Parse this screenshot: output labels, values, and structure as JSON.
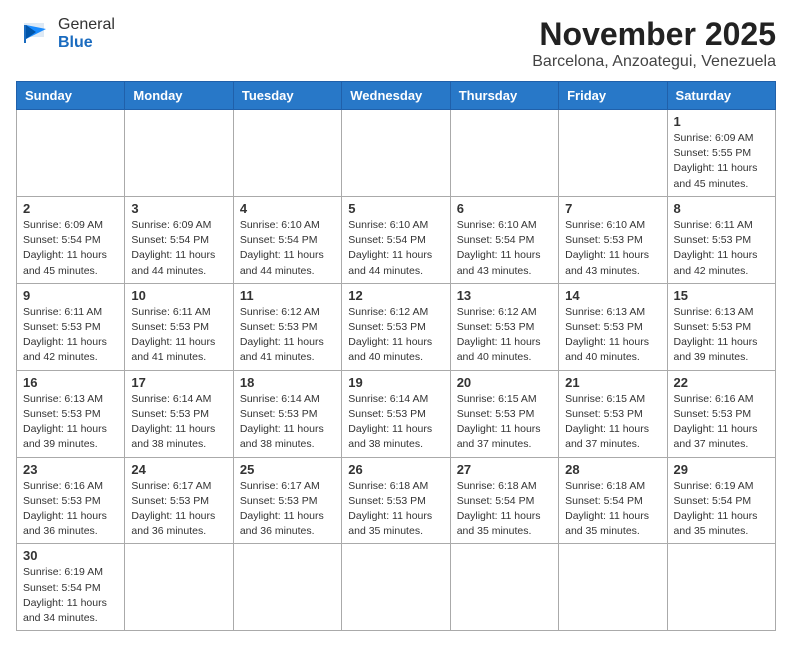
{
  "header": {
    "logo_general": "General",
    "logo_blue": "Blue",
    "month_year": "November 2025",
    "location": "Barcelona, Anzoategui, Venezuela"
  },
  "weekdays": [
    "Sunday",
    "Monday",
    "Tuesday",
    "Wednesday",
    "Thursday",
    "Friday",
    "Saturday"
  ],
  "weeks": [
    [
      {
        "day": "",
        "info": ""
      },
      {
        "day": "",
        "info": ""
      },
      {
        "day": "",
        "info": ""
      },
      {
        "day": "",
        "info": ""
      },
      {
        "day": "",
        "info": ""
      },
      {
        "day": "",
        "info": ""
      },
      {
        "day": "1",
        "info": "Sunrise: 6:09 AM\nSunset: 5:55 PM\nDaylight: 11 hours\nand 45 minutes."
      }
    ],
    [
      {
        "day": "2",
        "info": "Sunrise: 6:09 AM\nSunset: 5:54 PM\nDaylight: 11 hours\nand 45 minutes."
      },
      {
        "day": "3",
        "info": "Sunrise: 6:09 AM\nSunset: 5:54 PM\nDaylight: 11 hours\nand 44 minutes."
      },
      {
        "day": "4",
        "info": "Sunrise: 6:10 AM\nSunset: 5:54 PM\nDaylight: 11 hours\nand 44 minutes."
      },
      {
        "day": "5",
        "info": "Sunrise: 6:10 AM\nSunset: 5:54 PM\nDaylight: 11 hours\nand 44 minutes."
      },
      {
        "day": "6",
        "info": "Sunrise: 6:10 AM\nSunset: 5:54 PM\nDaylight: 11 hours\nand 43 minutes."
      },
      {
        "day": "7",
        "info": "Sunrise: 6:10 AM\nSunset: 5:53 PM\nDaylight: 11 hours\nand 43 minutes."
      },
      {
        "day": "8",
        "info": "Sunrise: 6:11 AM\nSunset: 5:53 PM\nDaylight: 11 hours\nand 42 minutes."
      }
    ],
    [
      {
        "day": "9",
        "info": "Sunrise: 6:11 AM\nSunset: 5:53 PM\nDaylight: 11 hours\nand 42 minutes."
      },
      {
        "day": "10",
        "info": "Sunrise: 6:11 AM\nSunset: 5:53 PM\nDaylight: 11 hours\nand 41 minutes."
      },
      {
        "day": "11",
        "info": "Sunrise: 6:12 AM\nSunset: 5:53 PM\nDaylight: 11 hours\nand 41 minutes."
      },
      {
        "day": "12",
        "info": "Sunrise: 6:12 AM\nSunset: 5:53 PM\nDaylight: 11 hours\nand 40 minutes."
      },
      {
        "day": "13",
        "info": "Sunrise: 6:12 AM\nSunset: 5:53 PM\nDaylight: 11 hours\nand 40 minutes."
      },
      {
        "day": "14",
        "info": "Sunrise: 6:13 AM\nSunset: 5:53 PM\nDaylight: 11 hours\nand 40 minutes."
      },
      {
        "day": "15",
        "info": "Sunrise: 6:13 AM\nSunset: 5:53 PM\nDaylight: 11 hours\nand 39 minutes."
      }
    ],
    [
      {
        "day": "16",
        "info": "Sunrise: 6:13 AM\nSunset: 5:53 PM\nDaylight: 11 hours\nand 39 minutes."
      },
      {
        "day": "17",
        "info": "Sunrise: 6:14 AM\nSunset: 5:53 PM\nDaylight: 11 hours\nand 38 minutes."
      },
      {
        "day": "18",
        "info": "Sunrise: 6:14 AM\nSunset: 5:53 PM\nDaylight: 11 hours\nand 38 minutes."
      },
      {
        "day": "19",
        "info": "Sunrise: 6:14 AM\nSunset: 5:53 PM\nDaylight: 11 hours\nand 38 minutes."
      },
      {
        "day": "20",
        "info": "Sunrise: 6:15 AM\nSunset: 5:53 PM\nDaylight: 11 hours\nand 37 minutes."
      },
      {
        "day": "21",
        "info": "Sunrise: 6:15 AM\nSunset: 5:53 PM\nDaylight: 11 hours\nand 37 minutes."
      },
      {
        "day": "22",
        "info": "Sunrise: 6:16 AM\nSunset: 5:53 PM\nDaylight: 11 hours\nand 37 minutes."
      }
    ],
    [
      {
        "day": "23",
        "info": "Sunrise: 6:16 AM\nSunset: 5:53 PM\nDaylight: 11 hours\nand 36 minutes."
      },
      {
        "day": "24",
        "info": "Sunrise: 6:17 AM\nSunset: 5:53 PM\nDaylight: 11 hours\nand 36 minutes."
      },
      {
        "day": "25",
        "info": "Sunrise: 6:17 AM\nSunset: 5:53 PM\nDaylight: 11 hours\nand 36 minutes."
      },
      {
        "day": "26",
        "info": "Sunrise: 6:18 AM\nSunset: 5:53 PM\nDaylight: 11 hours\nand 35 minutes."
      },
      {
        "day": "27",
        "info": "Sunrise: 6:18 AM\nSunset: 5:54 PM\nDaylight: 11 hours\nand 35 minutes."
      },
      {
        "day": "28",
        "info": "Sunrise: 6:18 AM\nSunset: 5:54 PM\nDaylight: 11 hours\nand 35 minutes."
      },
      {
        "day": "29",
        "info": "Sunrise: 6:19 AM\nSunset: 5:54 PM\nDaylight: 11 hours\nand 35 minutes."
      }
    ],
    [
      {
        "day": "30",
        "info": "Sunrise: 6:19 AM\nSunset: 5:54 PM\nDaylight: 11 hours\nand 34 minutes."
      },
      {
        "day": "",
        "info": ""
      },
      {
        "day": "",
        "info": ""
      },
      {
        "day": "",
        "info": ""
      },
      {
        "day": "",
        "info": ""
      },
      {
        "day": "",
        "info": ""
      },
      {
        "day": "",
        "info": ""
      }
    ]
  ]
}
